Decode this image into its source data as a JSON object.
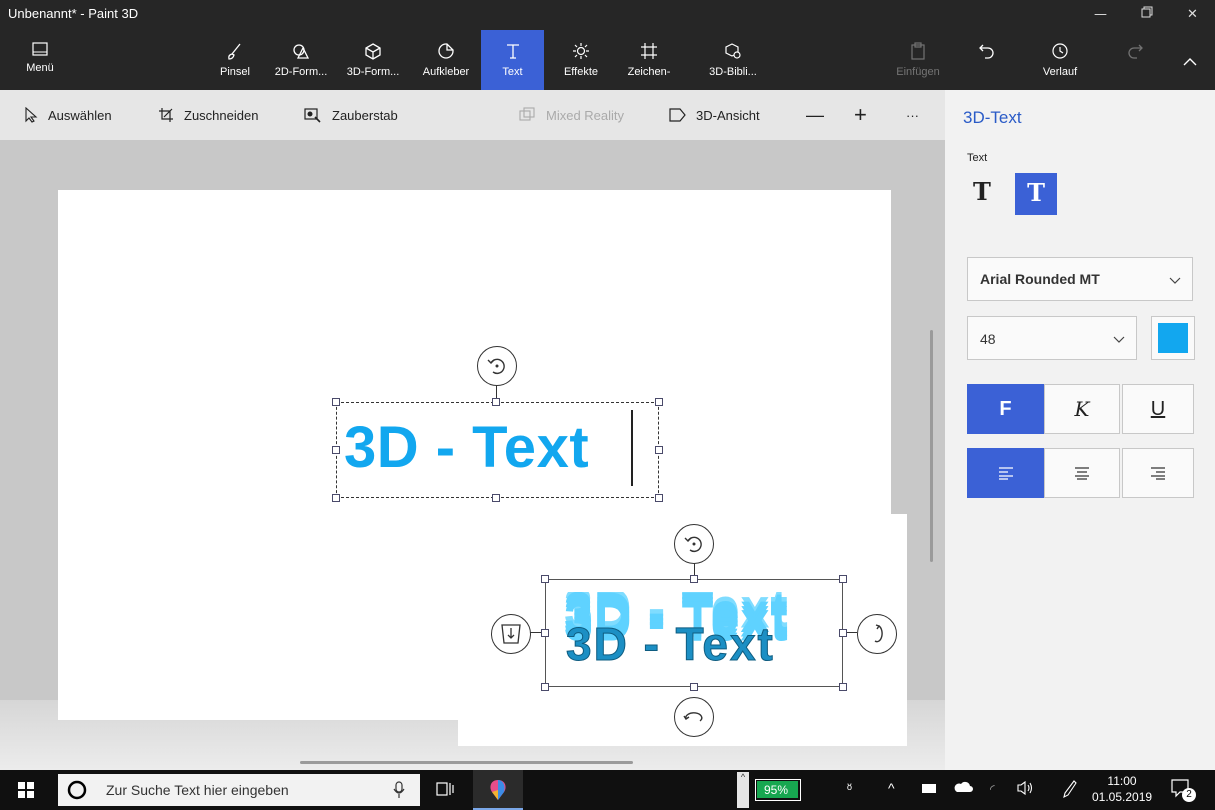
{
  "window": {
    "title": "Unbenannt* - Paint 3D"
  },
  "ribbon": {
    "menu": "Menü",
    "tools": [
      {
        "label": "Pinsel",
        "icon": "brush-icon"
      },
      {
        "label": "2D-Form...",
        "icon": "2d-shapes-icon"
      },
      {
        "label": "3D-Form...",
        "icon": "3d-shapes-icon"
      },
      {
        "label": "Aufkleber",
        "icon": "sticker-icon"
      },
      {
        "label": "Text",
        "icon": "text-icon",
        "active": true
      },
      {
        "label": "Effekte",
        "icon": "effects-icon"
      },
      {
        "label": "Zeichen-",
        "icon": "canvas-icon"
      },
      {
        "label": "3D-Bibli...",
        "icon": "3d-library-icon"
      }
    ],
    "paste": "Einfügen",
    "history": "Verlauf"
  },
  "toolbar2": {
    "select": "Auswählen",
    "crop": "Zuschneiden",
    "magic": "Zauberstab",
    "mixed": "Mixed Reality",
    "view3d": "3D-Ansicht",
    "more": "···"
  },
  "canvas": {
    "text2d": "3D - Text",
    "text3d": "3D - Text"
  },
  "panel": {
    "title": "3D-Text",
    "text_section": "Text",
    "font": "Arial Rounded MT",
    "size": "48",
    "color": "#12a7ef",
    "bold": "F",
    "italic": "K",
    "underline": "U"
  },
  "taskbar": {
    "search_placeholder": "Zur Suche Text hier eingeben",
    "battery": "95%",
    "time": "11:00",
    "date": "01.05.2019",
    "notifications": "2"
  },
  "colors": {
    "accent": "#3b61d6",
    "text_blue": "#12a7ef"
  }
}
